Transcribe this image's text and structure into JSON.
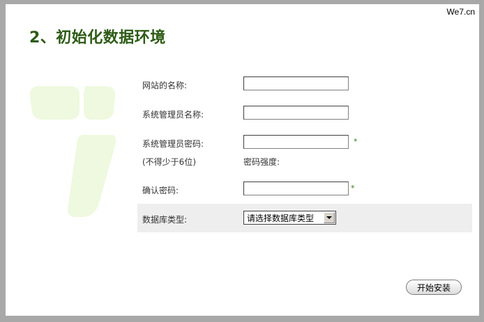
{
  "header": {
    "brand": "We7.cn",
    "title": "2、初始化数据环境"
  },
  "form": {
    "site_name": {
      "label": "网站的名称:",
      "value": ""
    },
    "admin_name": {
      "label": "系统管理员名称:",
      "value": ""
    },
    "admin_password": {
      "label": "系统管理员密码:",
      "value": "",
      "required_mark": "*",
      "hint": "(不得少于6位)",
      "strength_label": "密码强度:"
    },
    "confirm_password": {
      "label": "确认密码:",
      "value": "",
      "required_mark": "*"
    },
    "db_type": {
      "label": "数据库类型:",
      "selected": "请选择数据库类型"
    }
  },
  "actions": {
    "install_label": "开始安装"
  },
  "colors": {
    "title": "#2d5b16",
    "watermark": "#eef9df",
    "required": "#2d7d16"
  },
  "icons": {
    "watermark": "we7-logo-watermark",
    "dropdown": "chevron-down-icon"
  }
}
